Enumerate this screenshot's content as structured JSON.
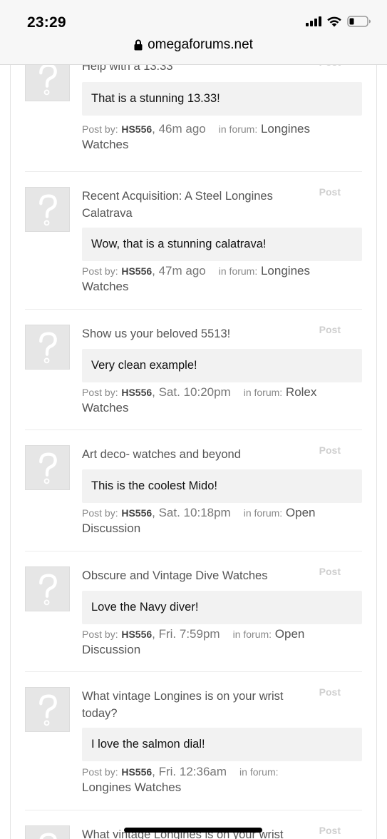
{
  "status_bar": {
    "time": "23:29"
  },
  "browser": {
    "url": "omegaforums.net"
  },
  "feed": {
    "items": [
      {
        "title": "Help with a 13.33",
        "type": "Post",
        "quote": "That is a stunning 13.33!",
        "meta_prefix": "Post by:",
        "user": "HS556",
        "time": "46m ago",
        "forum_prefix": "in forum:",
        "forum": "Longines Watches"
      },
      {
        "title": "Recent Acquisition: A Steel Longines Calatrava",
        "type": "Post",
        "quote": "Wow, that is a stunning calatrava!",
        "meta_prefix": "Post by:",
        "user": "HS556",
        "time": "47m ago",
        "forum_prefix": "in forum:",
        "forum": "Longines Watches"
      },
      {
        "title": "Show us your beloved 5513!",
        "type": "Post",
        "quote": "Very clean example!",
        "meta_prefix": "Post by:",
        "user": "HS556",
        "time": "Sat. 10:20pm",
        "forum_prefix": "in forum:",
        "forum": "Rolex Watches"
      },
      {
        "title": "Art deco- watches and beyond",
        "type": "Post",
        "quote": "This is the coolest Mido!",
        "meta_prefix": "Post by:",
        "user": "HS556",
        "time": "Sat. 10:18pm",
        "forum_prefix": "in forum:",
        "forum": "Open Discussion"
      },
      {
        "title": "Obscure and Vintage Dive Watches",
        "type": "Post",
        "quote": "Love the Navy diver!",
        "meta_prefix": "Post by:",
        "user": "HS556",
        "time": "Fri. 7:59pm",
        "forum_prefix": "in forum:",
        "forum": "Open Discussion"
      },
      {
        "title": "What vintage Longines is on your wrist today?",
        "type": "Post",
        "quote": "I love the salmon dial!",
        "meta_prefix": "Post by:",
        "user": "HS556",
        "time": "Fri. 12:36am",
        "forum_prefix": "in forum:",
        "forum": "Longines Watches"
      },
      {
        "title": "What vintage Longines is on your wrist",
        "type": "Post",
        "quote": "",
        "meta_prefix": "",
        "user": "",
        "time": "",
        "forum_prefix": "",
        "forum": ""
      }
    ]
  }
}
